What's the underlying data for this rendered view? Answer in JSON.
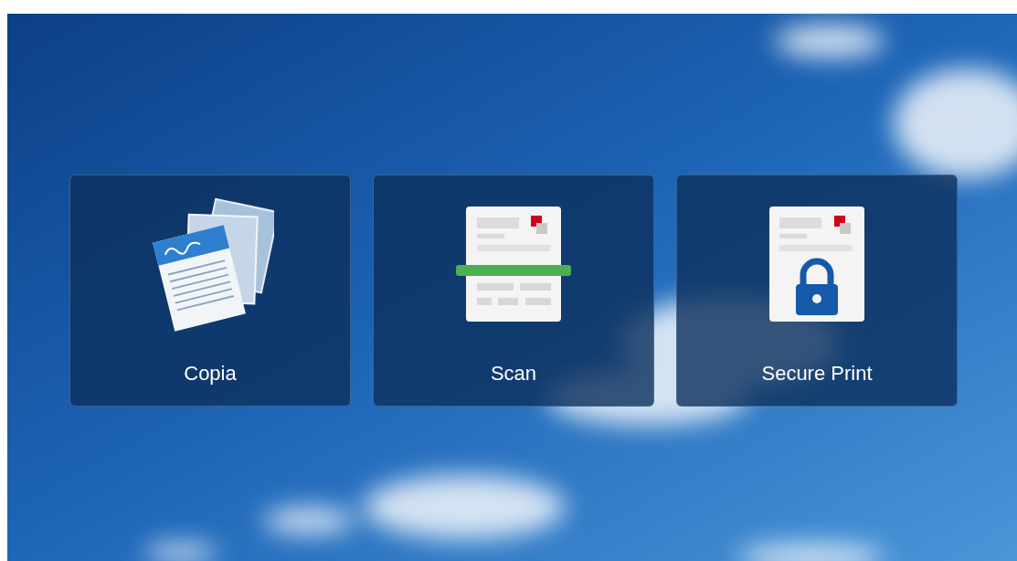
{
  "tiles": [
    {
      "kind": "copy",
      "label": "Copia"
    },
    {
      "kind": "scan",
      "label": "Scan"
    },
    {
      "kind": "secure-print",
      "label": "Secure Print"
    }
  ]
}
